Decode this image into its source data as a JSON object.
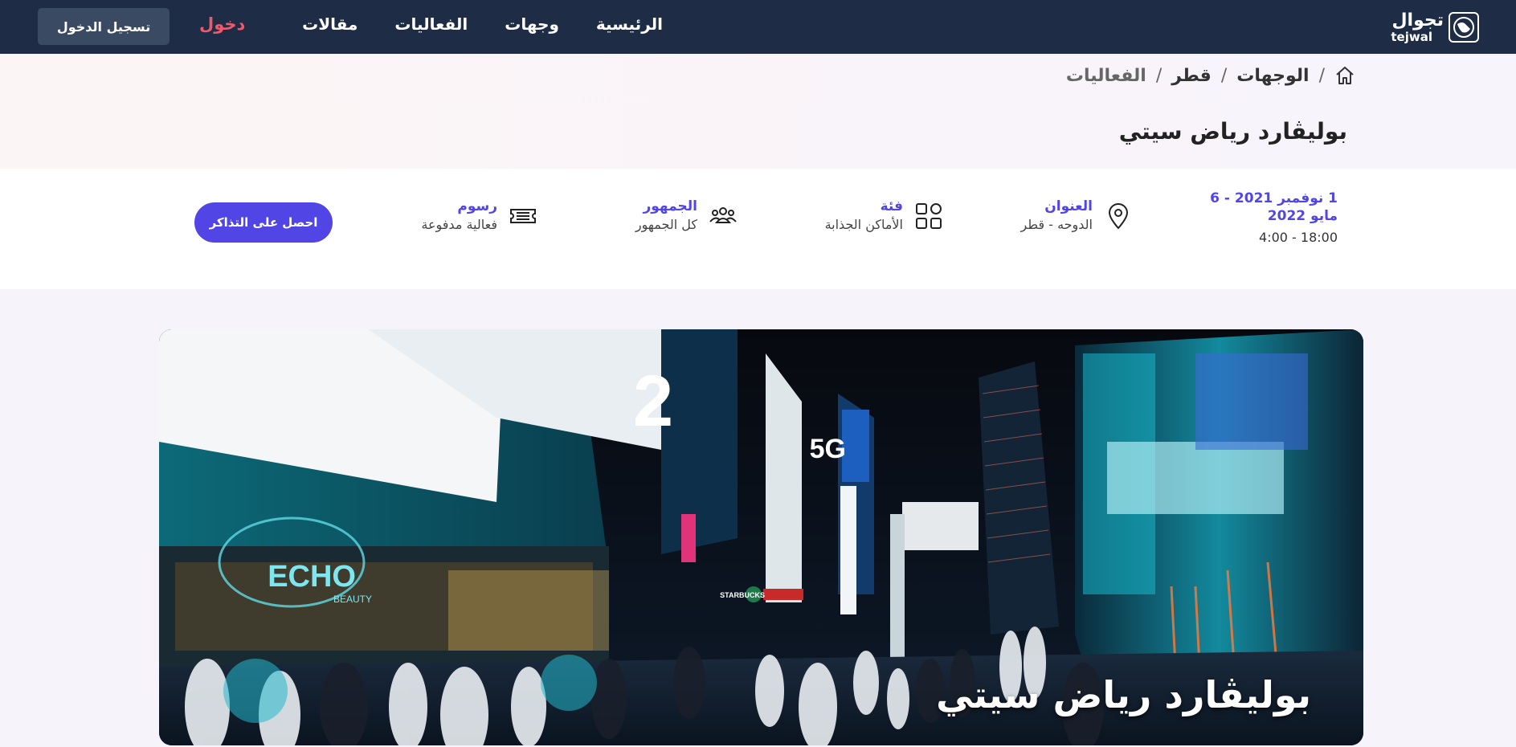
{
  "nav": {
    "logo_ar": "تجوال",
    "logo_en": "tejwal",
    "links": [
      "الرئيسية",
      "وجهات",
      "الفعاليات",
      "مقالات"
    ],
    "login": "دخول",
    "register": "تسجيل الدخول"
  },
  "breadcrumb": {
    "items": [
      "الوجهات",
      "قطر"
    ],
    "current": "الفعاليات",
    "separator": "/"
  },
  "page_title": "بوليڤارد رياض سيتي",
  "info": {
    "dates": "1 نوفمبر 2021 - 6 مايو 2022",
    "time": "4:00 - 18:00",
    "address_label": "العنوان",
    "address_value": "الدوحه - قطر",
    "category_label": "فئة",
    "category_value": "الأماكن الجذابة",
    "audience_label": "الجمهور",
    "audience_value": "كل الجمهور",
    "fees_label": "رسوم",
    "fees_value": "فعالية مدفوعة",
    "ticket_button": "احصل على التذاكر"
  },
  "hero": {
    "caption": "بوليڤارد رياض سيتي",
    "sign_echo": "ECHO",
    "sign_beauty": "BEAUTY",
    "sign_5g": "5G",
    "sign_2": "2",
    "sign_starbucks": "STARBUCKS"
  },
  "colors": {
    "navbar": "#1e2d45",
    "accent": "#5146e5",
    "login": "#ec5a6c"
  },
  "icons": [
    "home-icon",
    "location-pin-icon",
    "grid-icon",
    "people-icon",
    "ticket-icon"
  ]
}
